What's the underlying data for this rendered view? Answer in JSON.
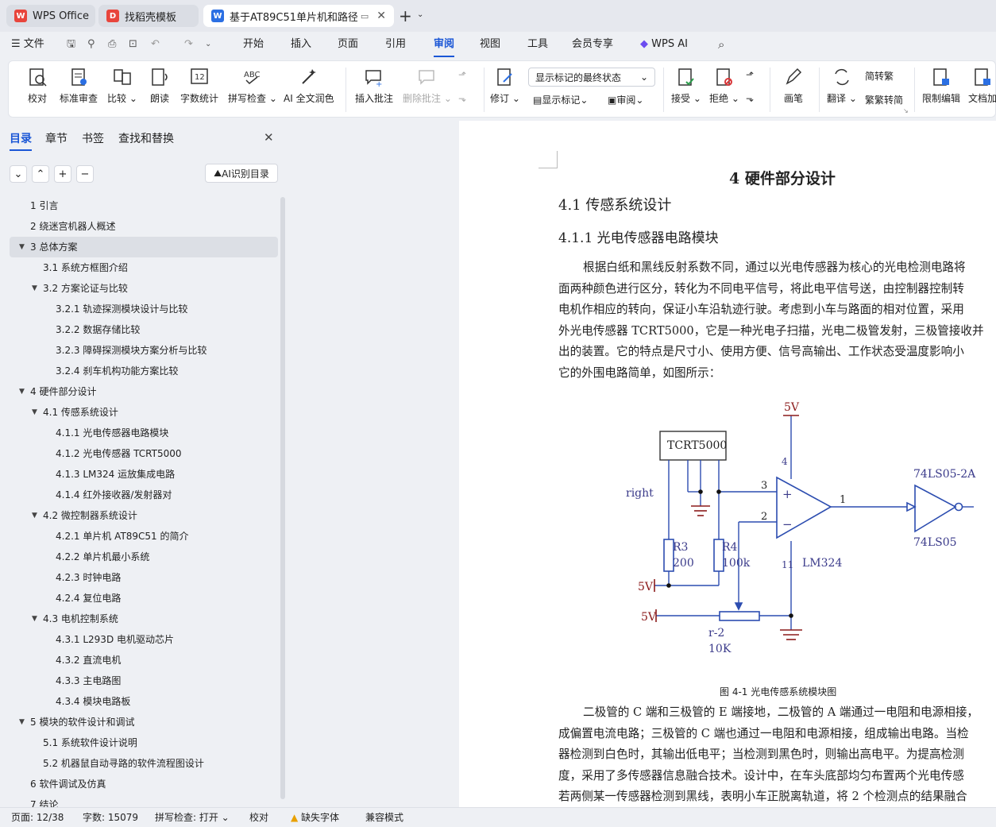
{
  "tabs": [
    {
      "label": "WPS Office",
      "icon": "wps-logo-icon",
      "color": "#e8453c"
    },
    {
      "label": "找稻壳模板",
      "icon": "docer-icon",
      "color": "#e8453c"
    },
    {
      "label": "基于AT89C51单片机和路径规",
      "icon": "word-doc-icon",
      "color": "#2b6fe3"
    }
  ],
  "menu": {
    "file": "文件",
    "items": [
      "开始",
      "插入",
      "页面",
      "引用",
      "审阅",
      "视图",
      "工具",
      "会员专享"
    ],
    "active": "审阅",
    "wps_ai": "WPS AI"
  },
  "ribbon": {
    "proofread": "校对",
    "standard_review": "标准审查",
    "compare": "比较",
    "read_aloud": "朗读",
    "word_count": "字数统计",
    "spell_check": "拼写检查",
    "ai_polish": "AI 全文润色",
    "insert_comment": "插入批注",
    "delete_comment": "删除批注",
    "track_changes": "修订",
    "display_state": "显示标记的最终状态",
    "show_markup": "显示标记",
    "review_pane": "审阅",
    "accept": "接受",
    "reject": "拒绝",
    "pen": "画笔",
    "translate": "翻译",
    "to_traditional": "转繁",
    "to_simplified": "繁转简",
    "restrict_edit": "限制编辑",
    "doc_encrypt": "文档加"
  },
  "sidebar": {
    "tabs": [
      "目录",
      "章节",
      "书签",
      "查找和替换"
    ],
    "ai_toc": "AI识别目录",
    "toc": [
      {
        "label": "1  引言",
        "level": 1,
        "arrow": ""
      },
      {
        "label": "2  绕迷宫机器人概述",
        "level": 1,
        "arrow": ""
      },
      {
        "label": "3 总体方案",
        "level": 1,
        "arrow": "▼",
        "selected": true
      },
      {
        "label": "3.1  系统方框图介绍",
        "level": 2,
        "arrow": ""
      },
      {
        "label": "3.2 方案论证与比较",
        "level": 2,
        "arrow": "▼"
      },
      {
        "label": "3.2.1 轨迹探测模块设计与比较",
        "level": 3,
        "arrow": ""
      },
      {
        "label": "3.2.2 数据存储比较",
        "level": 3,
        "arrow": ""
      },
      {
        "label": "3.2.3 障碍探测模块方案分析与比较",
        "level": 3,
        "arrow": ""
      },
      {
        "label": "3.2.4 刹车机构功能方案比较",
        "level": 3,
        "arrow": ""
      },
      {
        "label": "4 硬件部分设计",
        "level": 1,
        "arrow": "▼"
      },
      {
        "label": "4.1 传感系统设计",
        "level": 2,
        "arrow": "▼"
      },
      {
        "label": "4.1.1 光电传感器电路模块",
        "level": 3,
        "arrow": ""
      },
      {
        "label": "4.1.2 光电传感器 TCRT5000",
        "level": 3,
        "arrow": ""
      },
      {
        "label": "4.1.3 LM324 运放集成电路",
        "level": 3,
        "arrow": ""
      },
      {
        "label": "4.1.4 红外接收器/发射器对",
        "level": 3,
        "arrow": ""
      },
      {
        "label": "4.2 微控制器系统设计",
        "level": 2,
        "arrow": "▼"
      },
      {
        "label": "4.2.1  单片机 AT89C51 的简介",
        "level": 3,
        "arrow": ""
      },
      {
        "label": "4.2.2 单片机最小系统",
        "level": 3,
        "arrow": ""
      },
      {
        "label": "4.2.3 时钟电路",
        "level": 3,
        "arrow": ""
      },
      {
        "label": "4.2.4 复位电路",
        "level": 3,
        "arrow": ""
      },
      {
        "label": "4.3 电机控制系统",
        "level": 2,
        "arrow": "▼"
      },
      {
        "label": "4.3.1 L293D  电机驱动芯片",
        "level": 3,
        "arrow": ""
      },
      {
        "label": "4.3.2 直流电机",
        "level": 3,
        "arrow": ""
      },
      {
        "label": "4.3.3 主电路图",
        "level": 3,
        "arrow": ""
      },
      {
        "label": "4.3.4 模块电路板",
        "level": 3,
        "arrow": ""
      },
      {
        "label": "5  模块的软件设计和调试",
        "level": 1,
        "arrow": "▼"
      },
      {
        "label": "5.1  系统软件设计说明",
        "level": 2,
        "arrow": ""
      },
      {
        "label": "5.2  机器鼠自动寻路的软件流程图设计",
        "level": 2,
        "arrow": ""
      },
      {
        "label": "6 软件调试及仿真",
        "level": 1,
        "arrow": ""
      },
      {
        "label": "7 结论",
        "level": 1,
        "arrow": ""
      }
    ]
  },
  "document": {
    "h1": "4 硬件部分设计",
    "h2": "4.1 传感系统设计",
    "h3": "4.1.1 光电传感器电路模块",
    "para1": [
      "根据白纸和黑线反射系数不同，通过以光电传感器为核心的光电检测电路将",
      "面两种颜色进行区分，转化为不同电平信号，将此电平信号送，由控制器控制转",
      "电机作相应的转向，保证小车沿轨迹行驶。考虑到小车与路面的相对位置，采用",
      "外光电传感器 TCRT5000，它是一种光电子扫描，光电二极管发射，三极管接收并",
      "出的装置。它的特点是尺寸小、使用方便、信号高输出、工作状态受温度影响小",
      "它的外围电路简单，如图所示："
    ],
    "circuit": {
      "v5_top": "5V",
      "sensor": "TCRT5000",
      "pin4": "4",
      "pin3": "3",
      "pin2": "2",
      "pin1": "1",
      "pin11": "11",
      "plus": "+",
      "minus": "−",
      "right": "right",
      "r3": "R3",
      "r3v": "200",
      "r4": "R4",
      "r4v": "100k",
      "v5_left1": "5V",
      "v5_left2": "5V",
      "rpot": "r-2",
      "rpotv": "10K",
      "opamp": "LM324",
      "gate_top": "74LS05-2A",
      "gate_bottom": "74LS05"
    },
    "caption": "图 4-1 光电传感系统模块图",
    "para2": [
      "二极管的 C 端和三极管的 E 端接地，二极管的 A 端通过一电阻和电源相接，",
      "成偏置电流电路；三极管的 C 端也通过一电阻和电源相接，组成输出电路。当检",
      "器检测到白色时，其输出低电平；当检测到黑色时，则输出高电平。为提高检测",
      "度，采用了多传感器信息融合技术。设计中，在车头底部均匀布置两个光电传感",
      "若两侧某一传感器检测到黑线，表明小车正脱离轨道，将 2 个检测点的结果融合"
    ]
  },
  "status": {
    "page": "页面: 12/38",
    "words": "字数: 15079",
    "spell": "拼写检查: 打开",
    "proof": "校对",
    "missing_font": "缺失字体",
    "compat": "兼容模式"
  }
}
